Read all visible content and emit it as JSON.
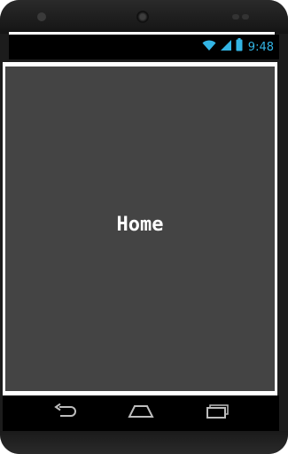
{
  "status_bar": {
    "time": "9:48",
    "icons": [
      "wifi-icon",
      "signal-icon",
      "battery-icon"
    ],
    "accent_color": "#33b5e5"
  },
  "app": {
    "label": "Home",
    "background_color": "#444444"
  },
  "nav_bar": {
    "buttons": [
      "back-icon",
      "home-icon",
      "recent-apps-icon"
    ]
  }
}
